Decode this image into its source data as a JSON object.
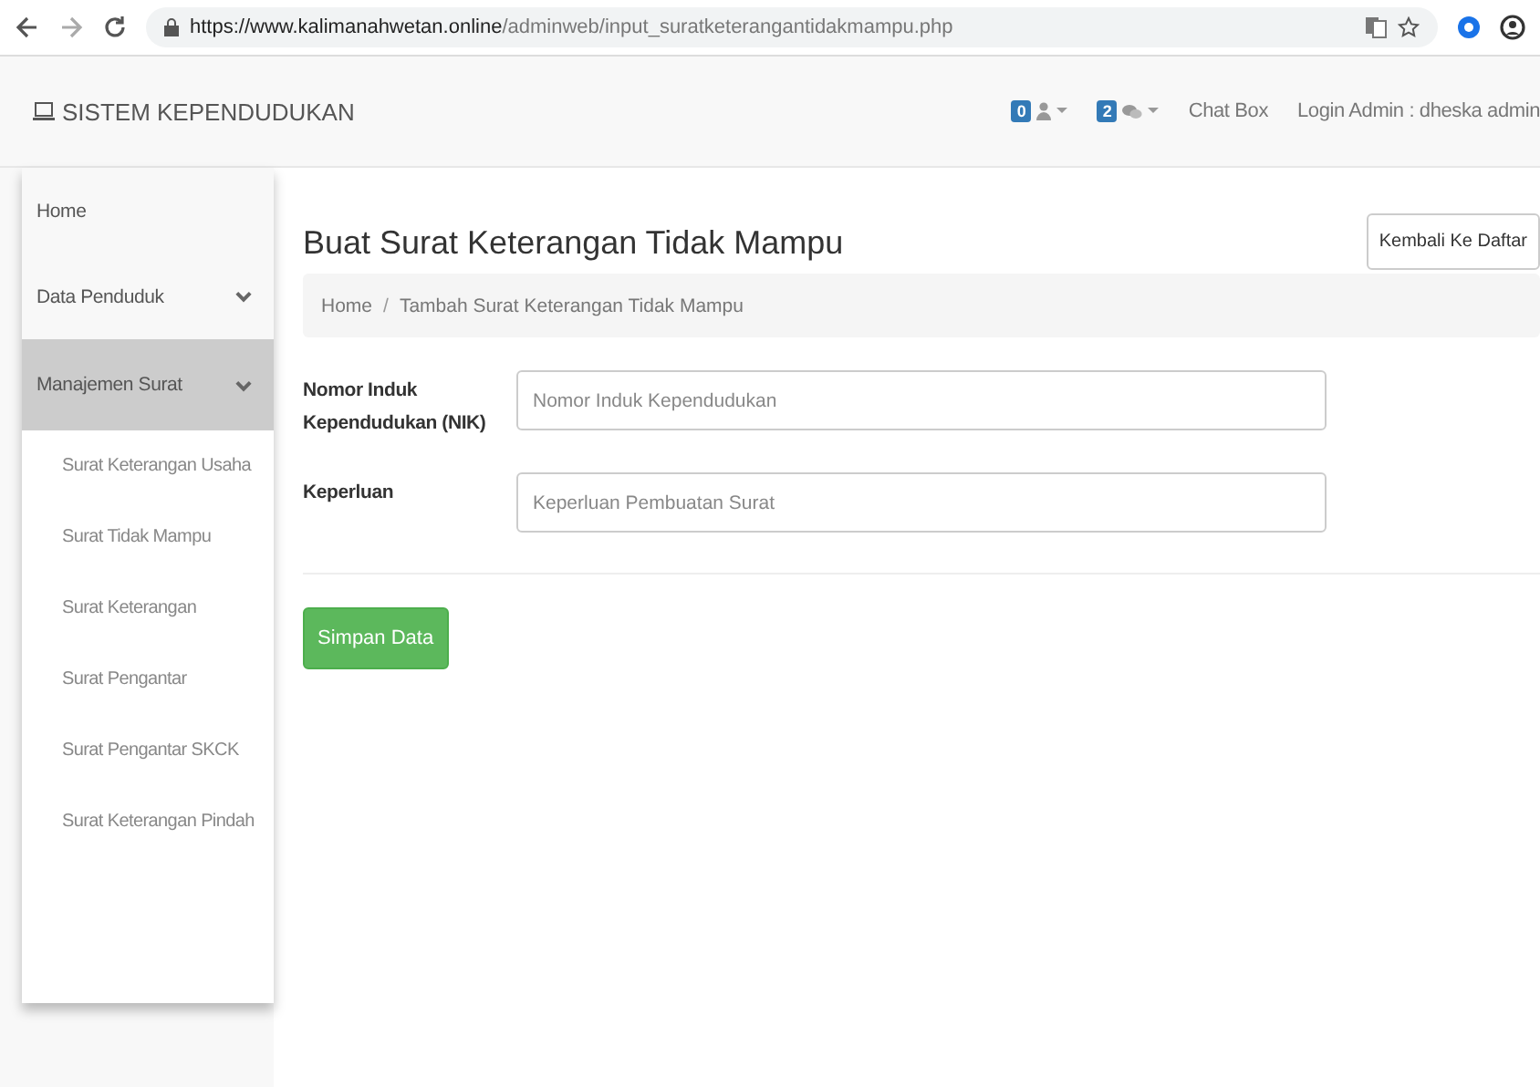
{
  "browser": {
    "url_host": "https://www.kalimanahwetan.online",
    "url_path": "/adminweb/input_suratketerangantidakmampu.php"
  },
  "navbar": {
    "brand": "SISTEM KEPENDUDUKAN",
    "user_badge": "0",
    "message_badge": "2",
    "links": [
      "Chat Box",
      "Login Admin : dheska admin"
    ]
  },
  "sidebar": {
    "items": [
      {
        "label": "Home",
        "selected": false
      },
      {
        "label": "Data Penduduk",
        "selected": false,
        "kind": "dropdown"
      },
      {
        "label": "Manajemen Surat",
        "selected": true,
        "kind": "dropdown",
        "children": [
          {
            "label": "Surat Keterangan Usaha"
          },
          {
            "label": "Surat Tidak Mampu"
          },
          {
            "label": "Surat Keterangan"
          },
          {
            "label": "Surat Pengantar"
          },
          {
            "label": "Surat Pengantar SKCK"
          },
          {
            "label": "Surat Keterangan Pindah"
          }
        ]
      }
    ]
  },
  "page": {
    "title": "Buat Surat Keterangan Tidak Mampu",
    "back_button": "Kembali Ke Daftar",
    "breadcrumb": [
      "Home",
      "Tambah Surat Keterangan Tidak Mampu"
    ],
    "breadcrumb_separator": "/",
    "fields": [
      {
        "label": "Nomor Induk Kependudukan (NIK)",
        "placeholder": "Nomor Induk Kependudukan"
      },
      {
        "label": "Keperluan",
        "placeholder": "Keperluan Pembuatan Surat"
      }
    ],
    "submit": "Simpan Data"
  }
}
